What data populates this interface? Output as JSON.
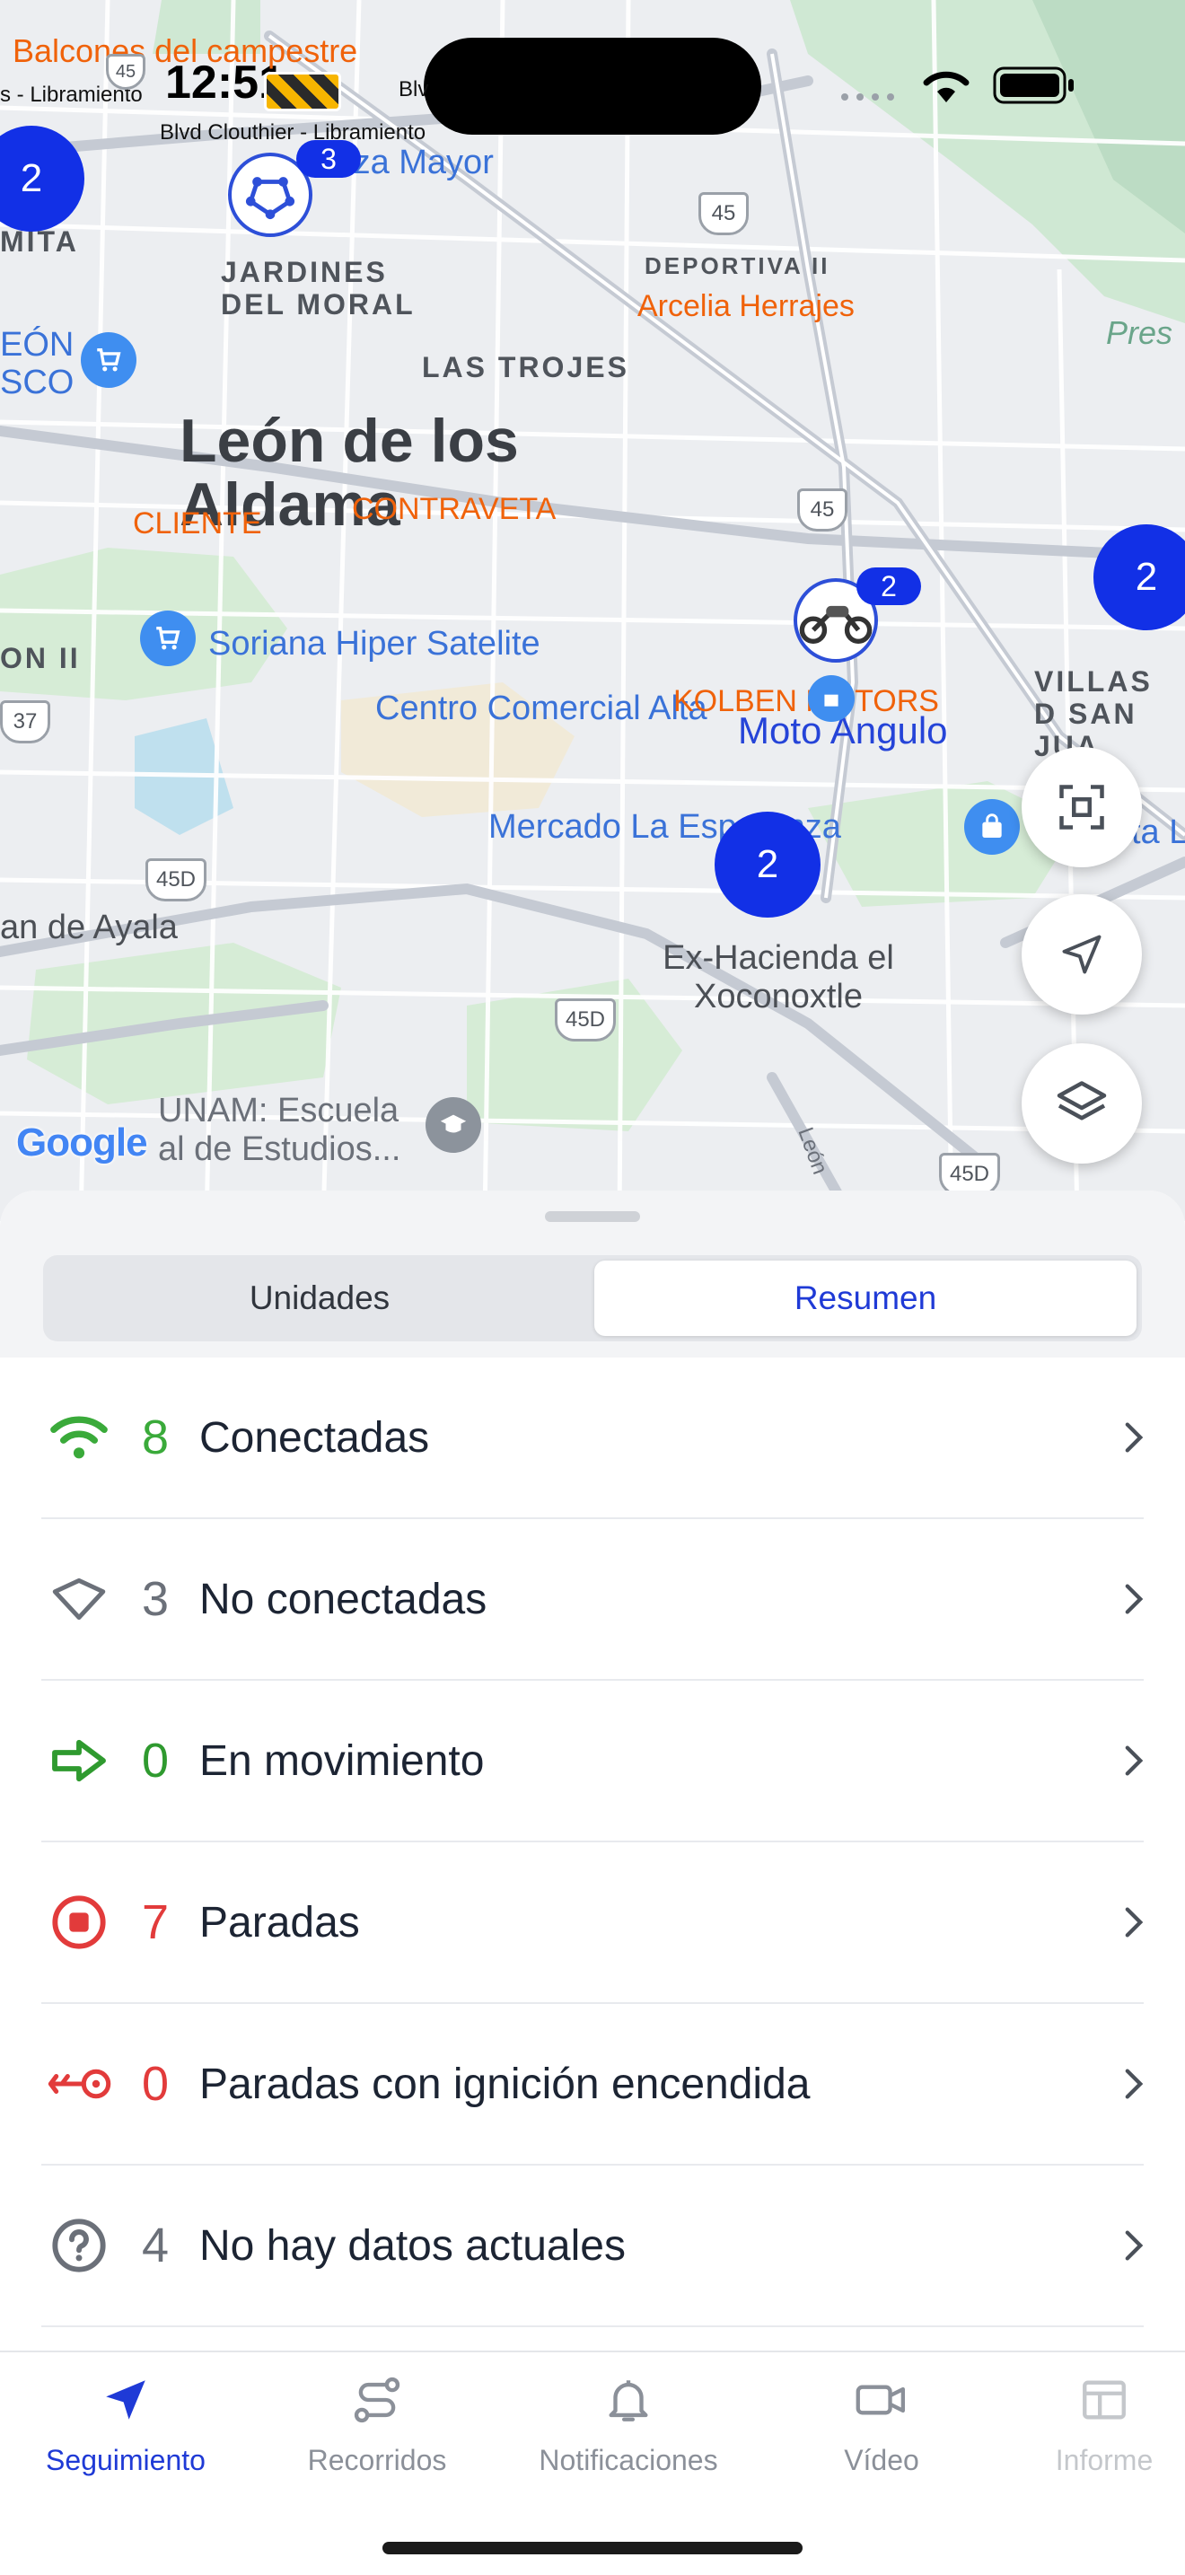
{
  "status_bar": {
    "time": "12:51"
  },
  "map": {
    "city": "León de los Aldama",
    "districts": {
      "jardines": "JARDINES DEL MORAL",
      "trojes": "LAS TROJES",
      "deportiva": "DEPORTIVA II",
      "hacienda": "Ex-Hacienda el Xoconoxtle",
      "villas": "VILLAS D SAN JUA",
      "ayala": "an de Ayala",
      "unam": "UNAM: Escuela al de Estudios...",
      "eon": "EÓN SCO",
      "mita": "MITA",
      "on2": "ON II",
      "presa": "Pres",
      "ta": "ta L"
    },
    "pois": {
      "soriana": "Soriana Hiper Satelite",
      "centro": "Centro Comercial Alta",
      "mercado": "Mercado La Esperanza",
      "plaza": "laza Mayor"
    },
    "custom_labels": {
      "balcones": "Balcones del campestre",
      "arcelia": "Arcelia Herrajes",
      "cliente": "CLIENTE",
      "contraveta": "CONTRAVETA",
      "kolben": "KOLBEN MOTORS",
      "moto": "Moto Angulo",
      "libramiento1": "s - Libramiento",
      "libramiento2": "Blvd Clouthier - Libramiento",
      "blv": "Blv"
    },
    "road_shields": {
      "s45a": "45",
      "s45b": "45",
      "s37": "37",
      "s45d1": "45D",
      "s45d2": "45D",
      "s45d3": "45D",
      "s45top": "45"
    },
    "road_name": "León",
    "clusters": {
      "left": "2",
      "right": "2",
      "center": "2"
    },
    "marker_badges": {
      "geofence": "3",
      "moto": "2"
    },
    "attribution": "Google"
  },
  "sheet": {
    "tabs": {
      "unidades": "Unidades",
      "resumen": "Resumen"
    },
    "active_tab": "Resumen",
    "rows": [
      {
        "count": "8",
        "label": "Conectadas",
        "icon": "wifi-icon",
        "color": "#3aaa3a"
      },
      {
        "count": "3",
        "label": "No conectadas",
        "icon": "diamond-outline-icon",
        "color": "#6b7079"
      },
      {
        "count": "0",
        "label": "En movimiento",
        "icon": "arrow-right-icon",
        "color": "#2f9a2f"
      },
      {
        "count": "7",
        "label": "Paradas",
        "icon": "stop-circle-icon",
        "color": "#e23b3b"
      },
      {
        "count": "0",
        "label": "Paradas con ignición encendida",
        "icon": "key-icon",
        "color": "#e23b3b"
      },
      {
        "count": "4",
        "label": "No hay datos actuales",
        "icon": "question-circle-icon",
        "color": "#6b7079"
      }
    ]
  },
  "tabbar": {
    "items": [
      {
        "label": "Seguimiento",
        "icon": "navigation-arrow-icon",
        "active": true
      },
      {
        "label": "Recorridos",
        "icon": "route-icon",
        "active": false
      },
      {
        "label": "Notificaciones",
        "icon": "bell-icon",
        "active": false
      },
      {
        "label": "Vídeo",
        "icon": "video-camera-icon",
        "active": false
      },
      {
        "label": "Informe",
        "icon": "table-icon",
        "active": false
      }
    ],
    "active_color": "#1f3ad6"
  }
}
